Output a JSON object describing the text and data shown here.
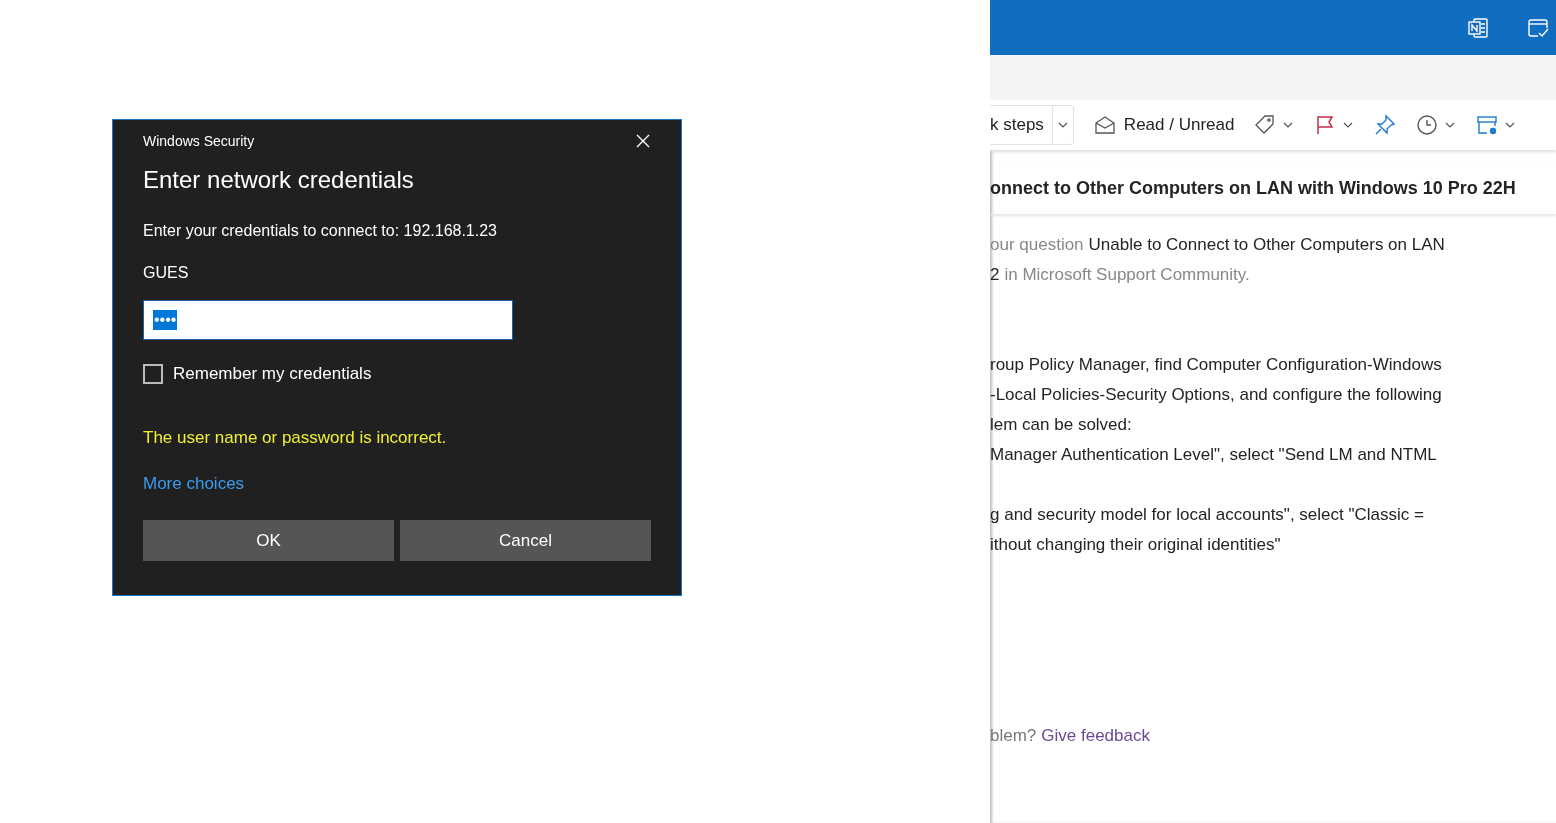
{
  "dialog": {
    "app_title": "Windows Security",
    "heading": "Enter network credentials",
    "prompt": "Enter your credentials to connect to: 192.168.1.23",
    "user_label": "GUES",
    "password": {
      "mask": "••••",
      "selected": true
    },
    "remember": {
      "label": "Remember my credentials",
      "checked": false
    },
    "error": "The user name or password is incorrect.",
    "more_link": "More choices",
    "buttons": [
      "OK",
      "Cancel"
    ]
  },
  "mail": {
    "toolbar": {
      "quick_steps": "k steps",
      "read_unread": "Read / Unread"
    },
    "subject": "onnect to Other Computers on LAN with Windows 10 Pro 22H",
    "reply_lines": [
      [
        {
          "text": "our question",
          "muted": true
        },
        {
          "text": "Unable to Connect to Other Computers on LAN",
          "muted": false
        }
      ],
      [
        {
          "text": "2",
          "muted": false
        },
        {
          "text": "in Microsoft Support Community.",
          "muted": true
        }
      ]
    ],
    "body_paragraphs": [
      [
        "roup Policy Manager, find Computer Configuration-Windows",
        "-Local Policies-Security Options, and configure the following",
        "lem can be solved:",
        "Manager Authentication Level\", select \"Send LM and NTML"
      ],
      [
        "g and security model for local accounts\", select \"Classic =",
        "ithout changing their original identities\""
      ]
    ],
    "feedback": {
      "prefix": "blem?",
      "link": "Give feedback"
    }
  }
}
